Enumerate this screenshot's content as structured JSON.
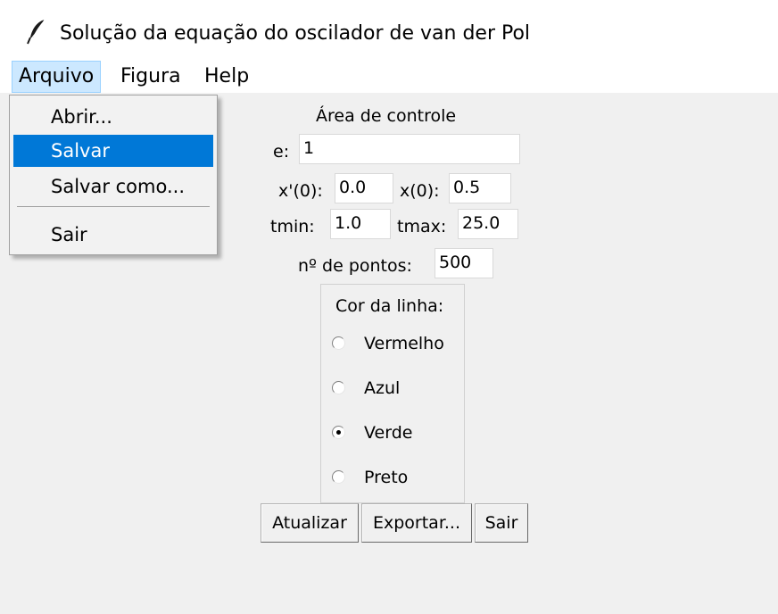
{
  "window": {
    "title": "Solução da equação do oscilador de van der Pol",
    "icon": "feather-icon"
  },
  "menubar": {
    "items": [
      {
        "label": "Arquivo",
        "active": true
      },
      {
        "label": "Figura"
      },
      {
        "label": "Help"
      }
    ]
  },
  "dropdown": {
    "items": [
      {
        "label": "Abrir..."
      },
      {
        "label": "Salvar",
        "highlighted": true
      },
      {
        "label": "Salvar como..."
      },
      {
        "label": "Sair"
      }
    ],
    "highlight_color": "#0078d7"
  },
  "control": {
    "title": "Área de controle",
    "e_label": "e:",
    "e_value": "1",
    "xprime0_label": "x'(0):",
    "xprime0_value": "0.0",
    "x0_label": "x(0):",
    "x0_value": "0.5",
    "tmin_label": "tmin:",
    "tmin_value": "1.0",
    "tmax_label": "tmax:",
    "tmax_value": "25.0",
    "npontos_label": "nº de pontos:",
    "npontos_value": "500"
  },
  "line_color": {
    "title": "Cor da linha:",
    "options": [
      {
        "label": "Vermelho",
        "selected": false
      },
      {
        "label": "Azul",
        "selected": false
      },
      {
        "label": "Verde",
        "selected": true
      },
      {
        "label": "Preto",
        "selected": false
      }
    ]
  },
  "buttons": {
    "update": "Atualizar",
    "export": "Exportar...",
    "quit": "Sair"
  }
}
